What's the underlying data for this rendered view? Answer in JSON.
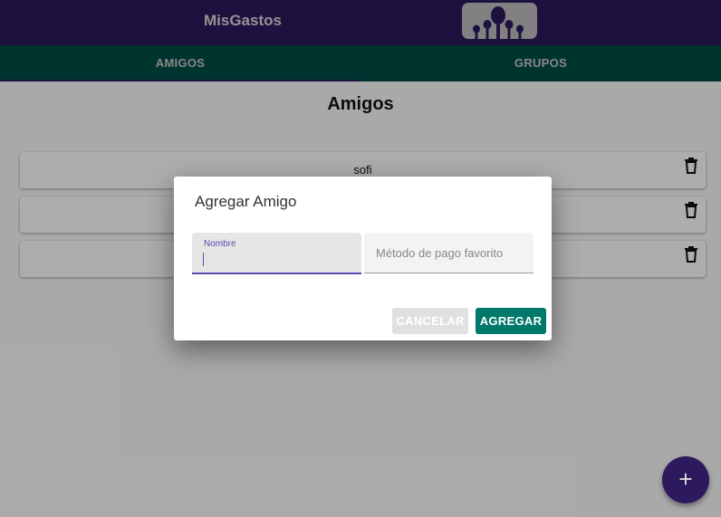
{
  "app": {
    "title": "MisGastos"
  },
  "tabs": [
    {
      "label": "AMIGOS",
      "selected": true
    },
    {
      "label": "GRUPOS",
      "selected": false
    }
  ],
  "page": {
    "title": "Amigos"
  },
  "friends": [
    {
      "name": "sofi"
    },
    {
      "name": ""
    },
    {
      "name": ""
    }
  ],
  "dialog": {
    "title": "Agregar Amigo",
    "fields": {
      "nombre": {
        "label": "Nombre",
        "value": ""
      },
      "metodo": {
        "placeholder": "Método de pago favorito",
        "value": ""
      }
    },
    "buttons": {
      "cancel": "CANCELAR",
      "add": "AGREGAR"
    }
  },
  "fab": {
    "label": "+"
  },
  "colors": {
    "primary": "#2d1a5e",
    "secondary": "#004d44",
    "accent": "#00796b",
    "focus": "#5e4bb0"
  },
  "icons": {
    "logo": "group-people-icon",
    "delete": "trash-icon",
    "fab": "plus-icon"
  }
}
